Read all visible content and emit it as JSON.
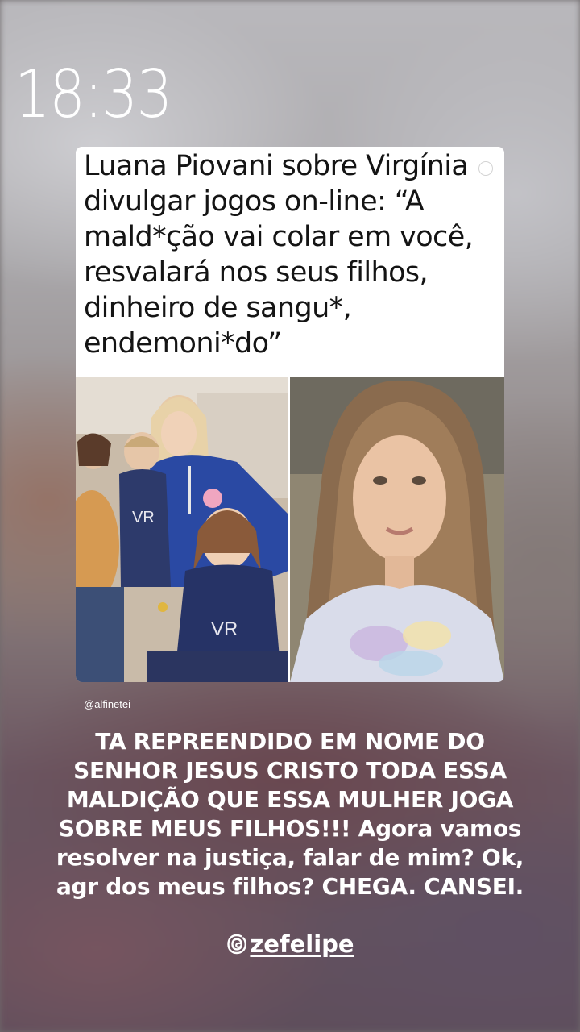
{
  "status": {
    "time": "18:33"
  },
  "post": {
    "headline_lines": [
      "Luana Piovani sobre Virgínia",
      "divulgar jogos on-line: “A",
      "mald*ção vai colar em você,",
      "resvalará nos seus filhos,",
      "dinheiro de sangu*,",
      "endemoni*do”"
    ],
    "credit": "@alfinetei"
  },
  "caption": {
    "lines": [
      "TA REPREENDIDO EM NOME DO",
      "SENHOR JESUS CRISTO TODA ESSA",
      "MALDIÇÃO QUE ESSA MULHER JOGA",
      "SOBRE MEUS FILHOS!!! Agora vamos",
      "resolver na justiça, falar de mim? Ok,",
      "agr dos meus filhos? CHEGA. CANSEI."
    ]
  },
  "mention": {
    "icon": "threads-icon",
    "handle": "zefelipe"
  },
  "shirt_logo": "VR"
}
